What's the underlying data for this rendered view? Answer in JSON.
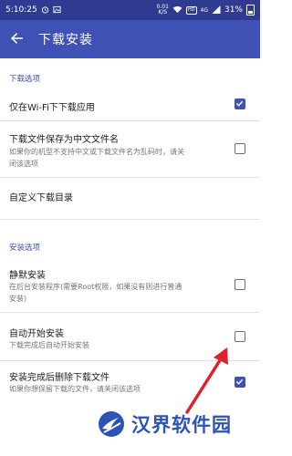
{
  "status_bar": {
    "time": "5:10:25",
    "net_speed_top": "0.01",
    "net_speed_bottom": "K/S",
    "hd_label": "HD",
    "network": "4G",
    "battery": "31%",
    "color": "#2f3b91"
  },
  "app_bar": {
    "title": "下载安装",
    "color": "#3f51b5"
  },
  "sections": {
    "download": {
      "header": "下载选项",
      "wifi_only": {
        "title": "仅在Wi-Fi下下载应用",
        "checked": true
      },
      "chinese_name": {
        "title": "下载文件保存为中文文件名",
        "summary_1": "如果你的机型不支持中文或下载文件名为乱码时，请关",
        "summary_2": "闭该选项",
        "checked": false
      },
      "custom_dir": {
        "title": "自定义下载目录"
      }
    },
    "install": {
      "header": "安装选项",
      "silent": {
        "title": "静默安装",
        "summary_1": "在后台安装程序(需要Root权限，如果没有则进行普通",
        "summary_2": "安装)",
        "checked": false
      },
      "auto_install": {
        "title": "自动开始安装",
        "summary": "下载完成后自动开始安装",
        "checked": false
      },
      "delete_after": {
        "title": "安装完成后删除下载文件",
        "summary": "如果你想保留下载的文件，请关闭该选项",
        "checked": true
      }
    }
  },
  "annotation": {
    "arrow_color": "#e0202a"
  },
  "watermark": {
    "text": "汉界软件园",
    "color": "#2b53b8"
  },
  "icons": {
    "back": "arrow-left-icon",
    "alarm": "alarm-icon",
    "image": "image-icon",
    "wifi": "wifi-icon",
    "signal": "signal-icon"
  }
}
